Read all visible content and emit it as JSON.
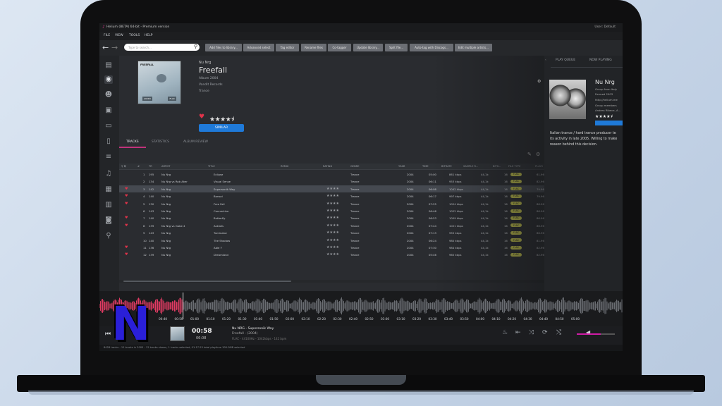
{
  "window": {
    "title": "Helium (BETA) 64-bit - Premium version",
    "user_label": "User:",
    "user": "Default"
  },
  "menu": [
    "FILE",
    "VIEW",
    "TOOLS",
    "HELP"
  ],
  "toolbar": {
    "search_placeholder": "Type to search...",
    "buttons": [
      "Add files to library...",
      "Advanced select",
      "Tag editor",
      "Rename files",
      "Co-tagger",
      "Update library...",
      "Split file...",
      "Auto-tag with Discogs...",
      "Edit multiple artists..."
    ]
  },
  "album": {
    "artist": "Nu Nrg",
    "title": "Freefall",
    "album_year": "Album 2004",
    "label": "Vandit Records",
    "genre": "Trance",
    "similar_label": "SIMILAR",
    "rating": 4.5,
    "cover_text": "FREEFALL",
    "cover_format_1": "AUDIO",
    "cover_format_2": "FLAC"
  },
  "tabs": [
    "TRACKS",
    "STATISTICS",
    "ALBUM REVIEW"
  ],
  "table": {
    "headers": [
      "#",
      "TR",
      "ARTIST",
      "TITLE",
      "REMIX",
      "RATING",
      "GENRE",
      "YEAR",
      "TIME",
      "BITRATE",
      "SAMPLE R...",
      "BITS...",
      "FILE TYPE",
      "PLAYS"
    ],
    "rows": [
      {
        "n": "1",
        "tr": "195",
        "artist": "Nu Nrg",
        "title": "Eclipse",
        "rating": "",
        "genre": "Trance",
        "year": "2004",
        "time": "05:00",
        "bitrate": "861 kbps",
        "sr": "44,1k",
        "bits": "16",
        "type": "FLAC",
        "plays": "61.96",
        "fav": false,
        "sel": false
      },
      {
        "n": "2",
        "tr": "134",
        "artist": "Nu Nrg vs Rob Aker",
        "title": "Visual Sense",
        "rating": "",
        "genre": "Trance",
        "year": "2004",
        "time": "06:11",
        "bitrate": "953 kbps",
        "sr": "44,1k",
        "bits": "16",
        "type": "FLAC",
        "plays": "82.96",
        "fav": false,
        "sel": false
      },
      {
        "n": "3",
        "tr": "142",
        "artist": "Nu Nrg",
        "title": "Supersonik Way",
        "rating": "★★★★",
        "genre": "Trance",
        "year": "2004",
        "time": "06:08",
        "bitrate": "1042 kbps",
        "sr": "44,1k",
        "bits": "16",
        "type": "FLAC",
        "plays": "79.96",
        "fav": true,
        "sel": true
      },
      {
        "n": "4",
        "tr": "140",
        "artist": "Nu Nrg",
        "title": "Bonsai",
        "rating": "★★★★",
        "genre": "Trance",
        "year": "2004",
        "time": "06:17",
        "bitrate": "997 kbps",
        "sr": "44,1k",
        "bits": "16",
        "type": "FLAC",
        "plays": "79.96",
        "fav": true,
        "sel": false
      },
      {
        "n": "5",
        "tr": "130",
        "artist": "Nu Nrg",
        "title": "Free Fall",
        "rating": "★★★★",
        "genre": "Trance",
        "year": "2004",
        "time": "07:25",
        "bitrate": "1024 kbps",
        "sr": "44,1k",
        "bits": "16",
        "type": "FLAC",
        "plays": "86.96",
        "fav": true,
        "sel": false
      },
      {
        "n": "6",
        "tr": "143",
        "artist": "Nu Nrg",
        "title": "Connective",
        "rating": "★★★★",
        "genre": "Trance",
        "year": "2004",
        "time": "06:46",
        "bitrate": "1022 kbps",
        "sr": "44,1k",
        "bits": "16",
        "type": "FLAC",
        "plays": "86.96",
        "fav": false,
        "sel": false
      },
      {
        "n": "7",
        "tr": "140",
        "artist": "Nu Nrg",
        "title": "Butterfly",
        "rating": "★★★★",
        "genre": "Trance",
        "year": "2004",
        "time": "06:53",
        "bitrate": "1009 kbps",
        "sr": "44,1k",
        "bits": "16",
        "type": "FLAC",
        "plays": "86.96",
        "fav": true,
        "sel": false
      },
      {
        "n": "8",
        "tr": "139",
        "artist": "Nu Nrg vs Gabe 4",
        "title": "Astralis",
        "rating": "★★★★",
        "genre": "Trance",
        "year": "2004",
        "time": "07:44",
        "bitrate": "1021 kbps",
        "sr": "44,1k",
        "bits": "16",
        "type": "FLAC",
        "plays": "86.96",
        "fav": true,
        "sel": false
      },
      {
        "n": "9",
        "tr": "143",
        "artist": "Nu Nrg",
        "title": "Tuminator",
        "rating": "★★★★",
        "genre": "Trance",
        "year": "2004",
        "time": "07:13",
        "bitrate": "955 kbps",
        "sr": "44,1k",
        "bits": "16",
        "type": "FLAC",
        "plays": "86.96",
        "fav": false,
        "sel": false
      },
      {
        "n": "10",
        "tr": "140",
        "artist": "Nu Nrg",
        "title": "The Shadow",
        "rating": "★★★★",
        "genre": "Trance",
        "year": "2004",
        "time": "06:24",
        "bitrate": "980 kbps",
        "sr": "44,1k",
        "bits": "16",
        "type": "FLAC",
        "plays": "81.96",
        "fav": false,
        "sel": false
      },
      {
        "n": "11",
        "tr": "136",
        "artist": "Nu Nrg",
        "title": "Able F",
        "rating": "★★★★",
        "genre": "Trance",
        "year": "2004",
        "time": "07:30",
        "bitrate": "984 kbps",
        "sr": "44,1k",
        "bits": "16",
        "type": "FLAC",
        "plays": "82.96",
        "fav": true,
        "sel": false
      },
      {
        "n": "12",
        "tr": "139",
        "artist": "Nu Nrg",
        "title": "Dreamland",
        "rating": "★★★★",
        "genre": "Trance",
        "year": "2004",
        "time": "05:46",
        "bitrate": "960 kbps",
        "sr": "44,1k",
        "bits": "16",
        "type": "FLAC",
        "plays": "82.96",
        "fav": true,
        "sel": false
      }
    ]
  },
  "right_panel": {
    "tabs": [
      "PLAY QUEUE",
      "NOW PLAYING"
    ],
    "artist": "Nu Nrg",
    "line1": "Group from Italy",
    "line2": "Formed 2003",
    "line3": "http://helium.me",
    "line4": "Group members",
    "line5": "Andrea Ribeca, A...",
    "bio1": "Italian trance / hard trance producer te",
    "bio2": "its activity in late 2005. Willing to make",
    "bio3": "reason behind this decision."
  },
  "timeline": [
    "00:40",
    "00:50",
    "01:00",
    "01:10",
    "01:20",
    "01:30",
    "01:40",
    "01:50",
    "02:00",
    "02:10",
    "02:20",
    "02:30",
    "02:40",
    "02:50",
    "03:00",
    "03:10",
    "03:20",
    "03:30",
    "03:40",
    "03:50",
    "04:00",
    "04:10",
    "04:20",
    "04:30",
    "04:40",
    "04:50",
    "05:00"
  ],
  "player": {
    "elapsed": "00:58",
    "total": "06:08",
    "now_title": "Nu NRG - Supersonik Way",
    "now_album": "Freefall - (2004)",
    "now_format": "FLAC - 44100Hz - 1042kbps - 142 bpm",
    "progress": 0.16,
    "volume": 0.63
  },
  "logo_letter": "N",
  "status": "8428 tracks - 12 tracks in 2005 - 12 tracks shown, 1 tracks selected, 01:17:23 total playtime 300.0MB selected"
}
